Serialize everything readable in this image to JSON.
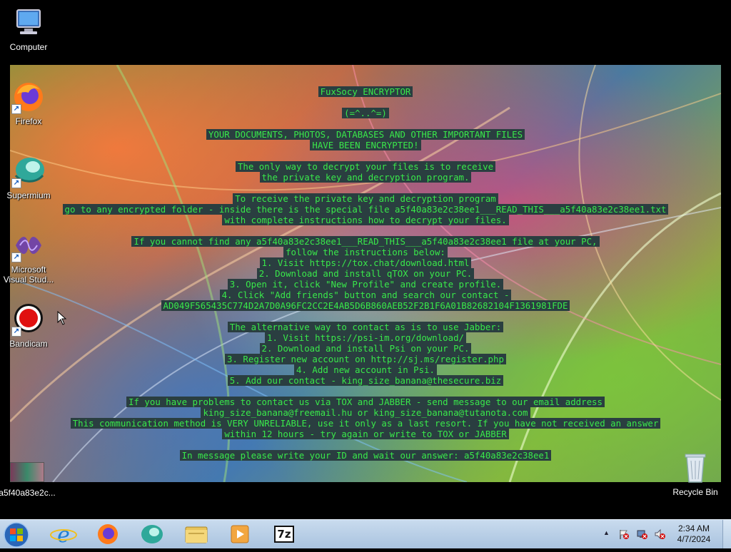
{
  "desktop": {
    "icons": [
      {
        "label": "Computer"
      },
      {
        "label": "Firefox"
      },
      {
        "label": "Supermium"
      },
      {
        "label": "Microsoft Visual Stud..."
      },
      {
        "label": "Bandicam"
      },
      {
        "label": "a5f40a83e2c..."
      },
      {
        "label": "Recycle Bin"
      }
    ]
  },
  "ransom_note": {
    "lines": [
      "FuxSocy ENCRYPTOR",
      "(=^..^=)",
      "YOUR DOCUMENTS, PHOTOS, DATABASES AND OTHER IMPORTANT FILES",
      "HAVE BEEN ENCRYPTED!",
      "The only way to decrypt your files is to receive",
      "the private key and decryption program.",
      "To receive the private key and decryption program",
      "go to any encrypted folder - inside there is the special file a5f40a83e2c38ee1___READ_THIS___a5f40a83e2c38ee1.txt",
      "with complete instructions how to decrypt your files.",
      "If you cannot find any a5f40a83e2c38ee1___READ_THIS___a5f40a83e2c38ee1 file at your PC,",
      "follow the instructions below:",
      "1. Visit https://tox.chat/download.html",
      "2. Download and install qTOX on your PC.",
      "3. Open it, click \"New Profile\" and create profile.",
      "4. Click \"Add friends\" button and search our contact -",
      "AD049F565435C774D2A7D0A96FC2CC2E4AB5D6B860AEB52F2B1F6A01B82682104F1361981FDE",
      "The alternative way to contact as is to use Jabber:",
      "1. Visit https://psi-im.org/download/",
      "2. Download and install Psi on your PC.",
      "3. Register new account on http://sj.ms/register.php",
      "4. Add new account in Psi.",
      "5. Add our contact - king_size_banana@thesecure.biz",
      "If you have problems to contact us via TOX and JABBER - send message to our email address",
      "king_size_banana@freemail.hu or king_size_banana@tutanota.com",
      "This communication method is VERY UNRELIABLE, use it only as a last resort. If you have not received an answer",
      "within 12 hours - try again or write to TOX or JABBER",
      "In message please write your ID and wait our answer: a5f40a83e2c38ee1"
    ]
  },
  "taskbar": {
    "clock_time": "2:34 AM",
    "clock_date": "4/7/2024",
    "tray_chevron": "▲",
    "apps": [
      "start-orb",
      "internet-explorer",
      "firefox",
      "supermium",
      "file-explorer",
      "media-player",
      "7zip"
    ],
    "sevenzip_label": "7z"
  }
}
